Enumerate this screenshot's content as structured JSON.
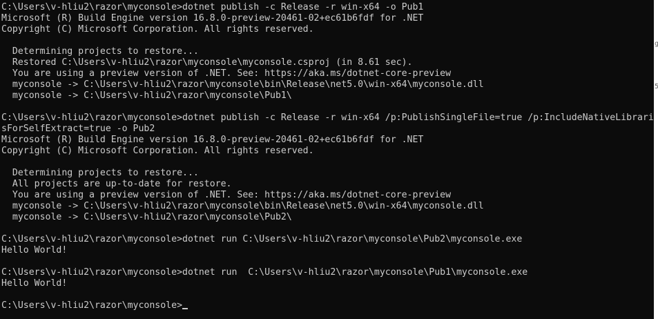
{
  "terminal": {
    "lines": [
      "C:\\Users\\v-hliu2\\razor\\myconsole>dotnet publish -c Release -r win-x64 -o Pub1",
      "Microsoft (R) Build Engine version 16.8.0-preview-20461-02+ec61b6fdf for .NET",
      "Copyright (C) Microsoft Corporation. All rights reserved.",
      "",
      "  Determining projects to restore...",
      "  Restored C:\\Users\\v-hliu2\\razor\\myconsole\\myconsole.csproj (in 8.61 sec).",
      "  You are using a preview version of .NET. See: https://aka.ms/dotnet-core-preview",
      "  myconsole -> C:\\Users\\v-hliu2\\razor\\myconsole\\bin\\Release\\net5.0\\win-x64\\myconsole.dll",
      "  myconsole -> C:\\Users\\v-hliu2\\razor\\myconsole\\Pub1\\",
      "",
      "C:\\Users\\v-hliu2\\razor\\myconsole>dotnet publish -c Release -r win-x64 /p:PublishSingleFile=true /p:IncludeNativeLibrari",
      "sForSelfExtract=true -o Pub2",
      "Microsoft (R) Build Engine version 16.8.0-preview-20461-02+ec61b6fdf for .NET",
      "Copyright (C) Microsoft Corporation. All rights reserved.",
      "",
      "  Determining projects to restore...",
      "  All projects are up-to-date for restore.",
      "  You are using a preview version of .NET. See: https://aka.ms/dotnet-core-preview",
      "  myconsole -> C:\\Users\\v-hliu2\\razor\\myconsole\\bin\\Release\\net5.0\\win-x64\\myconsole.dll",
      "  myconsole -> C:\\Users\\v-hliu2\\razor\\myconsole\\Pub2\\",
      "",
      "C:\\Users\\v-hliu2\\razor\\myconsole>dotnet run C:\\Users\\v-hliu2\\razor\\myconsole\\Pub2\\myconsole.exe",
      "Hello World!",
      "",
      "C:\\Users\\v-hliu2\\razor\\myconsole>dotnet run  C:\\Users\\v-hliu2\\razor\\myconsole\\Pub1\\myconsole.exe",
      "Hello World!",
      "",
      "C:\\Users\\v-hliu2\\razor\\myconsole>"
    ],
    "edge_glyphs": [
      "g",
      "5"
    ],
    "colors": {
      "background": "#0c0c0c",
      "foreground": "#cccccc"
    }
  }
}
